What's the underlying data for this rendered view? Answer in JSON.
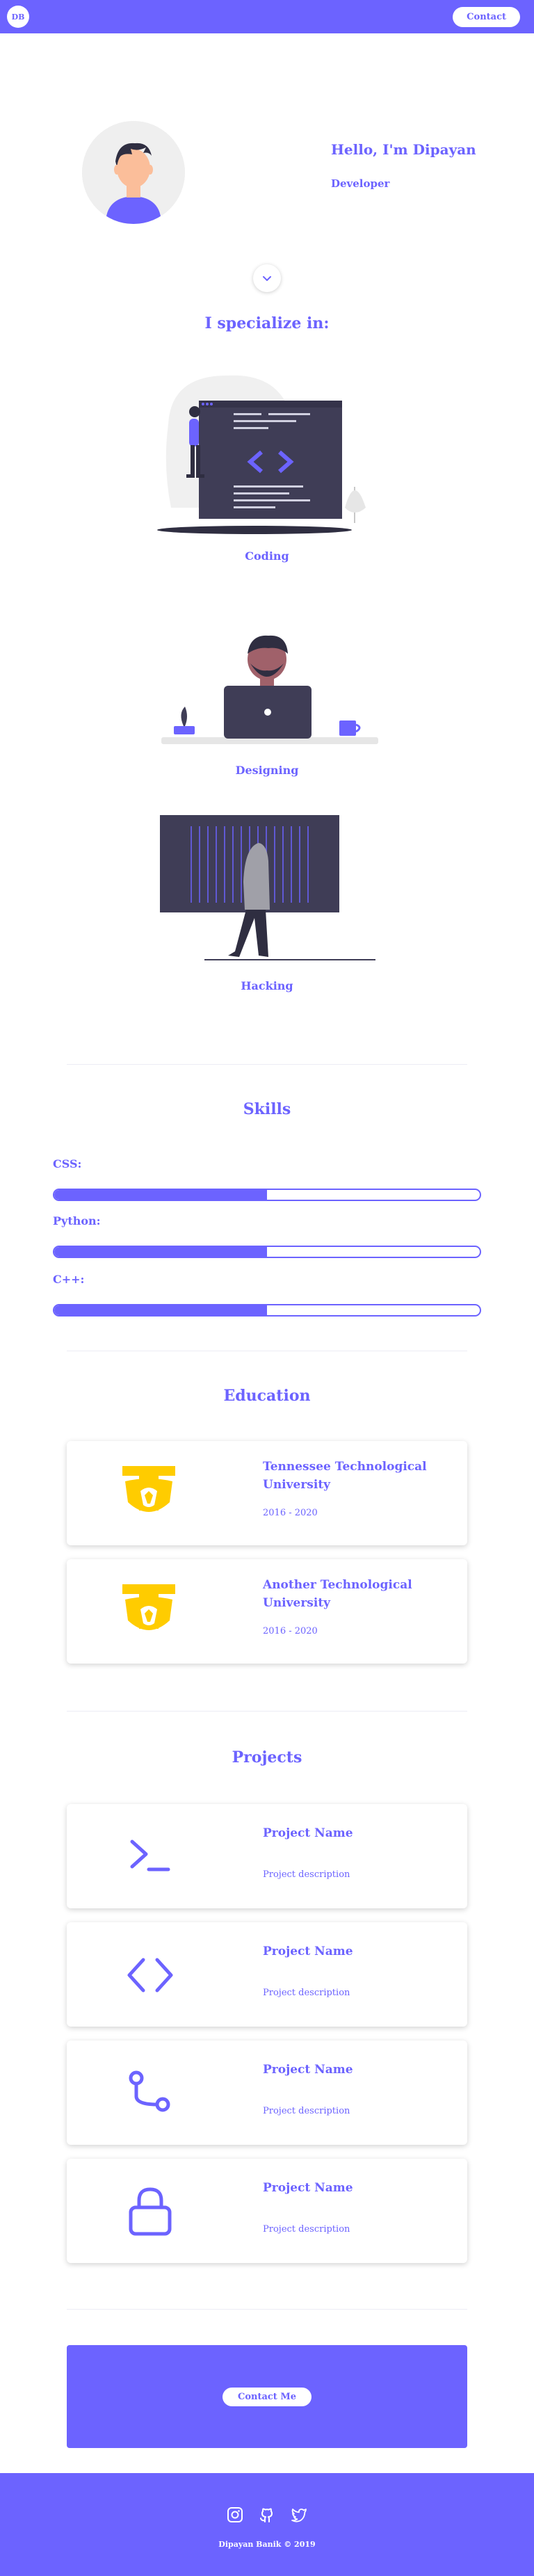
{
  "nav": {
    "logo": "DB",
    "contact_label": "Contact"
  },
  "hero": {
    "greeting": "Hello, I'm Dipayan",
    "role": "Developer"
  },
  "specialize": {
    "title": "I specialize in:",
    "items": [
      {
        "label": "Coding"
      },
      {
        "label": "Designing"
      },
      {
        "label": "Hacking"
      }
    ]
  },
  "skills": {
    "title": "Skills",
    "items": [
      {
        "label": "CSS:",
        "level": 0.5
      },
      {
        "label": "Python:",
        "level": 0.5
      },
      {
        "label": "C++:",
        "level": 0.5
      }
    ]
  },
  "education": {
    "title": "Education",
    "items": [
      {
        "school": "Tennessee Technological University",
        "years": "2016 - 2020"
      },
      {
        "school": "Another Technological University",
        "years": "2016 - 2020"
      }
    ]
  },
  "projects": {
    "title": "Projects",
    "items": [
      {
        "name": "Project Name",
        "description": "Project description",
        "icon": "terminal-icon"
      },
      {
        "name": "Project Name",
        "description": "Project description",
        "icon": "code-icon"
      },
      {
        "name": "Project Name",
        "description": "Project description",
        "icon": "git-branch-icon"
      },
      {
        "name": "Project Name",
        "description": "Project description",
        "icon": "lock-icon"
      }
    ]
  },
  "contact": {
    "button_label": "Contact Me"
  },
  "footer": {
    "icons": [
      "instagram-icon",
      "github-icon",
      "twitter-icon"
    ],
    "copyright": "Dipayan Banik © 2019"
  },
  "colors": {
    "accent": "#6c63ff",
    "logo_yellow": "#ffcc00"
  }
}
